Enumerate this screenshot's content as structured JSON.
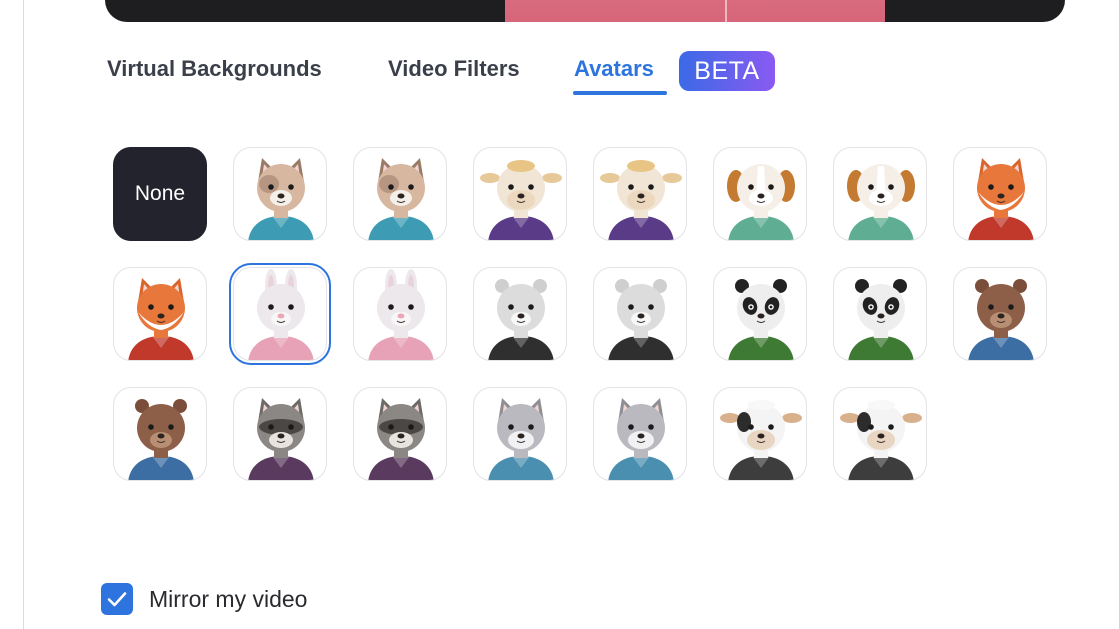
{
  "tabs": [
    {
      "label": "Virtual Backgrounds",
      "active": false
    },
    {
      "label": "Video Filters",
      "active": false
    },
    {
      "label": "Avatars",
      "active": true
    }
  ],
  "beta_badge": "BETA",
  "avatars": [
    {
      "label": "None",
      "kind": "none"
    },
    {
      "icon": "cat-avatar-icon",
      "animal": "cat",
      "head": "#d7b7a0",
      "ear": "#9a7b66",
      "shirt": "#3d9cb3"
    },
    {
      "icon": "cat-avatar-icon",
      "animal": "cat",
      "head": "#d7b7a0",
      "ear": "#9a7b66",
      "shirt": "#3d9cb3"
    },
    {
      "icon": "cow-avatar-icon",
      "animal": "cow",
      "head": "#f1e6d6",
      "ear": "#e7c898",
      "shirt": "#5a3b87"
    },
    {
      "icon": "cow-avatar-icon",
      "animal": "cow",
      "head": "#f1e6d6",
      "ear": "#e7c898",
      "shirt": "#5a3b87"
    },
    {
      "icon": "dog-avatar-icon",
      "animal": "dog",
      "head": "#f5efe8",
      "ear": "#c47b31",
      "shirt": "#5fae93"
    },
    {
      "icon": "dog-avatar-icon",
      "animal": "dog",
      "head": "#f5efe8",
      "ear": "#c47b31",
      "shirt": "#5fae93"
    },
    {
      "icon": "fox-avatar-icon",
      "animal": "fox",
      "head": "#e7773a",
      "ear": "#d9642c",
      "shirt": "#c0392b"
    },
    {
      "icon": "fox-avatar-icon",
      "animal": "fox",
      "head": "#e7773a",
      "ear": "#d9642c",
      "shirt": "#c0392b"
    },
    {
      "icon": "rabbit-avatar-icon",
      "animal": "rabbit",
      "head": "#ece8ec",
      "ear": "#e9d2dc",
      "shirt": "#e7a2b7",
      "selected": true
    },
    {
      "icon": "rabbit-avatar-icon",
      "animal": "rabbit",
      "head": "#ece8ec",
      "ear": "#e9d2dc",
      "shirt": "#e7a2b7"
    },
    {
      "icon": "polar-bear-avatar-icon",
      "animal": "bear",
      "head": "#dcdcdc",
      "ear": "#cfcfcf",
      "shirt": "#2f2f2f"
    },
    {
      "icon": "polar-bear-avatar-icon",
      "animal": "bear",
      "head": "#dcdcdc",
      "ear": "#cfcfcf",
      "shirt": "#2f2f2f"
    },
    {
      "icon": "panda-avatar-icon",
      "animal": "panda",
      "head": "#eeeeee",
      "ear": "#222222",
      "shirt": "#3f7a34"
    },
    {
      "icon": "panda-avatar-icon",
      "animal": "panda",
      "head": "#eeeeee",
      "ear": "#222222",
      "shirt": "#3f7a34"
    },
    {
      "icon": "beaver-avatar-icon",
      "animal": "beaver",
      "head": "#8d5f48",
      "ear": "#7a4e3a",
      "shirt": "#3c6ea3"
    },
    {
      "icon": "beaver-avatar-icon",
      "animal": "beaver",
      "head": "#8d5f48",
      "ear": "#7a4e3a",
      "shirt": "#3c6ea3"
    },
    {
      "icon": "raccoon-avatar-icon",
      "animal": "raccoon",
      "head": "#8a8784",
      "ear": "#6d6a67",
      "shirt": "#5a3a5e"
    },
    {
      "icon": "raccoon-avatar-icon",
      "animal": "raccoon",
      "head": "#8a8784",
      "ear": "#6d6a67",
      "shirt": "#5a3a5e"
    },
    {
      "icon": "wolf-avatar-icon",
      "animal": "wolf",
      "head": "#b9b9bf",
      "ear": "#8e8e95",
      "shirt": "#4b8fb0"
    },
    {
      "icon": "wolf-avatar-icon",
      "animal": "wolf",
      "head": "#b9b9bf",
      "ear": "#8e8e95",
      "shirt": "#4b8fb0"
    },
    {
      "icon": "cow-avatar-icon",
      "animal": "cow2",
      "head": "#f4f4f4",
      "ear": "#d9b08c",
      "shirt": "#3d3d3d"
    },
    {
      "icon": "cow-avatar-icon",
      "animal": "cow2",
      "head": "#f4f4f4",
      "ear": "#d9b08c",
      "shirt": "#3d3d3d"
    }
  ],
  "mirror": {
    "label": "Mirror my video",
    "checked": true
  },
  "colors": {
    "accent": "#2d74df",
    "badge_start": "#3b6ae6",
    "badge_end": "#8a5af2"
  }
}
